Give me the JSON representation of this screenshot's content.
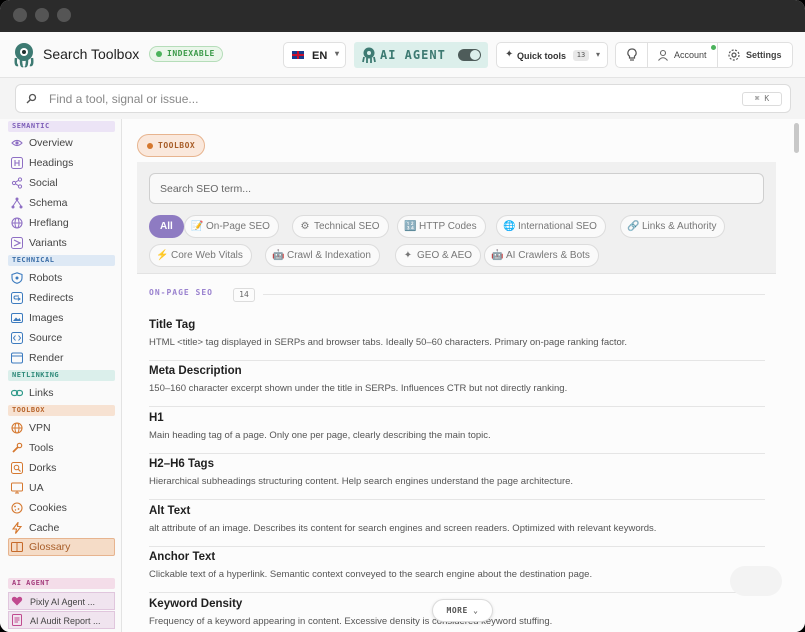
{
  "header": {
    "title": "Search Toolbox",
    "status_badge": "INDEXABLE",
    "language": "EN",
    "ai_agent_label": "AI AGENT",
    "ai_agent_enabled": true,
    "quick_tools_label": "Quick tools",
    "quick_tools_count": "13",
    "account_label": "Account",
    "settings_label": "Settings"
  },
  "search": {
    "placeholder": "Find a tool, signal or issue...",
    "shortcut": "⌘ K"
  },
  "sidebar": {
    "sections": [
      {
        "label": "SEMANTIC",
        "items": [
          "Overview",
          "Headings",
          "Social",
          "Schema",
          "Hreflang",
          "Variants"
        ]
      },
      {
        "label": "TECHNICAL",
        "items": [
          "Robots",
          "Redirects",
          "Images",
          "Source",
          "Render"
        ]
      },
      {
        "label": "NETLINKING",
        "items": [
          "Links"
        ]
      },
      {
        "label": "TOOLBOX",
        "items": [
          "VPN",
          "Tools",
          "Dorks",
          "UA",
          "Cookies",
          "Cache",
          "Glossary"
        ]
      },
      {
        "label": "AI AGENT",
        "items": [
          "Pixly AI Agent ...",
          "AI Audit Report ..."
        ]
      }
    ],
    "active_item": "Glossary",
    "colors": {
      "semantic": "#8e6fc4",
      "technical": "#3c7bbf",
      "netlinking": "#2f9a8a",
      "toolbox": "#d5782f",
      "ai_agent": "#b24a8c"
    }
  },
  "main": {
    "section_badge": "TOOLBOX",
    "term_search_placeholder": "Search SEO term...",
    "filters": [
      {
        "label": "All",
        "icon": ""
      },
      {
        "label": "On-Page SEO",
        "icon": "📝"
      },
      {
        "label": "Technical SEO",
        "icon": "⚙"
      },
      {
        "label": "HTTP Codes",
        "icon": "🔢"
      },
      {
        "label": "International SEO",
        "icon": "🌐"
      },
      {
        "label": "Links & Authority",
        "icon": "🔗"
      },
      {
        "label": "Core Web Vitals",
        "icon": "⚡"
      },
      {
        "label": "Crawl & Indexation",
        "icon": "🤖"
      },
      {
        "label": "GEO & AEO",
        "icon": "✦"
      },
      {
        "label": "AI Crawlers & Bots",
        "icon": "🤖"
      }
    ],
    "selected_filter": "All",
    "category": {
      "label": "ON-PAGE SEO",
      "count": "14"
    },
    "terms": [
      {
        "name": "Title Tag",
        "desc": "HTML <title> tag displayed in SERPs and browser tabs. Ideally 50–60 characters. Primary on-page ranking factor."
      },
      {
        "name": "Meta Description",
        "desc": "150–160 character excerpt shown under the title in SERPs. Influences CTR but not directly ranking."
      },
      {
        "name": "H1",
        "desc": "Main heading tag of a page. Only one per page, clearly describing the main topic."
      },
      {
        "name": "H2–H6 Tags",
        "desc": "Hierarchical subheadings structuring content. Help search engines understand the page architecture."
      },
      {
        "name": "Alt Text",
        "desc": "alt attribute of an image. Describes its content for search engines and screen readers. Optimized with relevant keywords."
      },
      {
        "name": "Anchor Text",
        "desc": "Clickable text of a hyperlink. Semantic context conveyed to the search engine about the destination page."
      },
      {
        "name": "Keyword Density",
        "desc": "Frequency of a keyword appearing in content. Excessive density is considered keyword stuffing."
      }
    ],
    "more_label": "MORE ⌄"
  }
}
